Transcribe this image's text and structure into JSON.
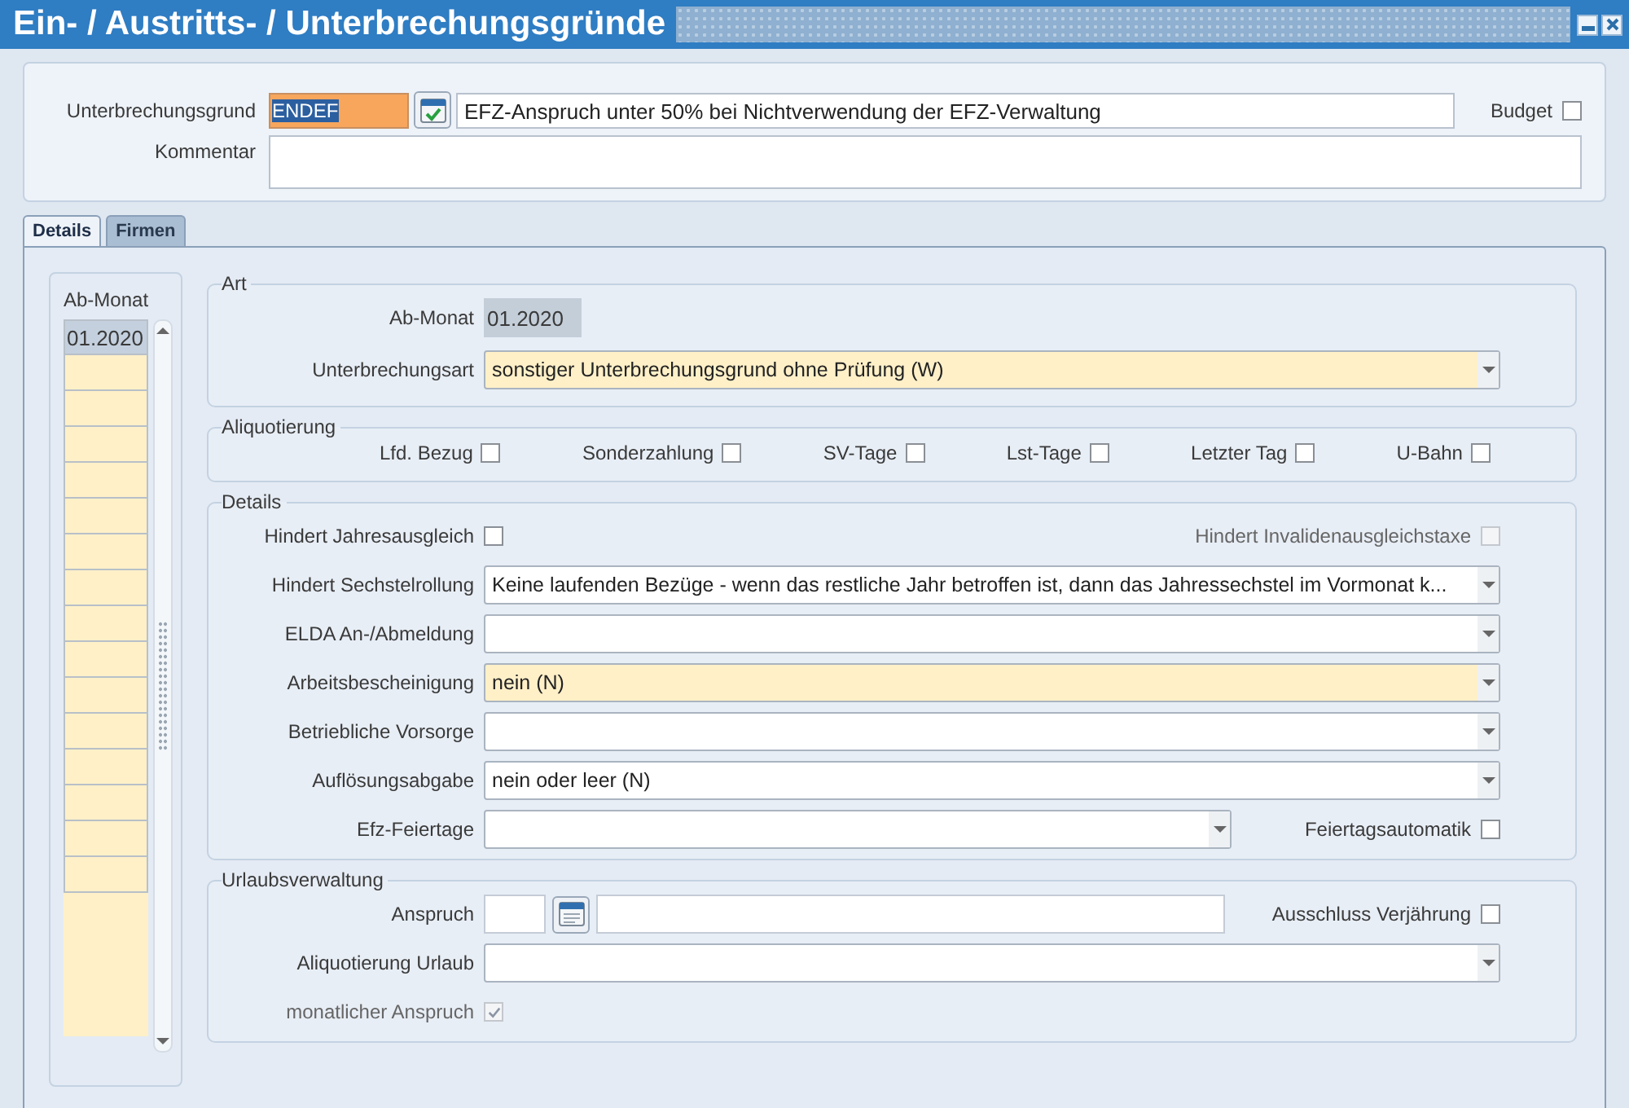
{
  "window": {
    "title": "Ein- / Austritts- / Unterbrechungsgründe"
  },
  "header": {
    "reason_label": "Unterbrechungsgrund",
    "reason_code": "ENDEF",
    "code_selected": true,
    "reason_text": "EFZ-Anspruch unter 50% bei Nichtverwendung der EFZ-Verwaltung",
    "budget": {
      "label": "Budget",
      "checked": false
    },
    "comment_label": "Kommentar"
  },
  "tabs": [
    {
      "label": "Details",
      "selected": true
    },
    {
      "label": "Firmen",
      "selected": false
    }
  ],
  "months": {
    "title": "Ab-Monat",
    "rows": [
      {
        "value": "01.2020",
        "selected": true
      }
    ]
  },
  "art": {
    "title": "Art",
    "month_label": "Ab-Monat",
    "month_value": "01.2020",
    "type_label": "Unterbrechungsart",
    "type_value": "sonstiger Unterbrechungsgrund ohne Prüfung (W)",
    "type_required": true
  },
  "aliquotierung": {
    "title": "Aliquotierung",
    "checks": [
      {
        "label": "Lfd. Bezug",
        "checked": false
      },
      {
        "label": "Sonderzahlung",
        "checked": false
      },
      {
        "label": "SV-Tage",
        "checked": false
      },
      {
        "label": "Lst-Tage",
        "checked": false
      },
      {
        "label": "Letzter Tag",
        "checked": false
      },
      {
        "label": "U-Bahn",
        "checked": false
      }
    ]
  },
  "details": {
    "title": "Details",
    "rows": [
      {
        "kind": "checks",
        "left": {
          "label": "Hindert Jahresausgleich",
          "checked": false,
          "disabled": false
        },
        "right": {
          "label": "Hindert Invalidenausgleichstaxe",
          "checked": false,
          "disabled": true
        }
      },
      {
        "kind": "select",
        "label": "Hindert Sechstelrollung",
        "value": "Keine laufenden Bezüge - wenn das restliche Jahr betroffen ist, dann das Jahressechstel im Vormonat k...",
        "required": false
      },
      {
        "kind": "select",
        "label": "ELDA An-/Abmeldung",
        "required": false
      },
      {
        "kind": "select",
        "label": "Arbeitsbescheinigung",
        "value": "nein (N)",
        "required": true
      },
      {
        "kind": "select",
        "label": "Betriebliche Vorsorge",
        "required": false
      },
      {
        "kind": "select",
        "label": "Auflösungsabgabe",
        "value": "nein oder leer (N)",
        "required": false
      },
      {
        "kind": "select-check",
        "label": "Efz-Feiertage",
        "required": false,
        "check": {
          "label": "Feiertagsautomatik",
          "checked": false,
          "disabled": false
        }
      }
    ]
  },
  "urlaub": {
    "title": "Urlaubsverwaltung",
    "rows": [
      {
        "kind": "date-check",
        "label": "Anspruch",
        "check": {
          "label": "Ausschluss Verjährung",
          "checked": false,
          "disabled": false
        }
      },
      {
        "kind": "select",
        "label": "Aliquotierung Urlaub",
        "required": false
      },
      {
        "kind": "check",
        "label": "monatlicher Anspruch",
        "checked": true,
        "disabled": true
      }
    ]
  }
}
